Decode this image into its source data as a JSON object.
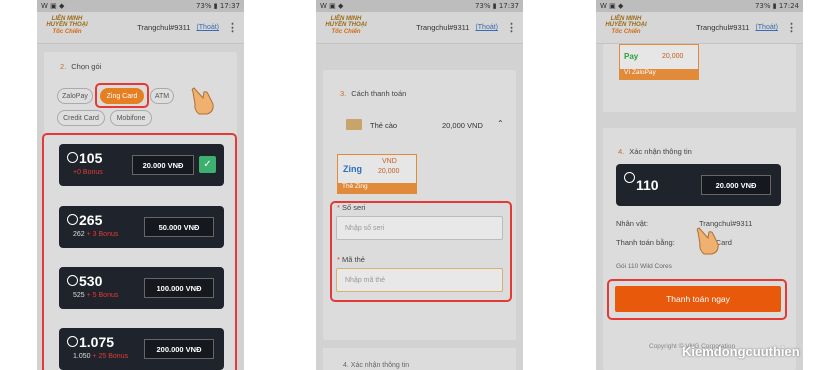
{
  "status": {
    "time1": "17:37",
    "time2": "17:37",
    "time3": "17:24",
    "battery": "73%"
  },
  "header": {
    "logo_line1": "LIÊN MINH",
    "logo_line2": "HUYỀN THOẠI",
    "logo_tag": "Tốc Chiến",
    "user": "Trangchul#9311",
    "logout": "(Thoát)"
  },
  "panel1": {
    "section_num": "2.",
    "section_title": "Chọn gói",
    "methods": [
      "ZaloPay",
      "Zing Card",
      "ATM",
      "Credit Card",
      "Mobifone"
    ],
    "packages": [
      {
        "amount": "105",
        "sub_base": "",
        "sub_bonus": "+0 Bonus",
        "price": "20.000 VNĐ"
      },
      {
        "amount": "265",
        "sub_base": "262",
        "sub_bonus": "+ 3 Bonus",
        "price": "50.000 VNĐ"
      },
      {
        "amount": "530",
        "sub_base": "525",
        "sub_bonus": "+ 5 Bonus",
        "price": "100.000 VNĐ"
      },
      {
        "amount": "1.075",
        "sub_base": "1.050",
        "sub_bonus": "+ 25 Bonus",
        "price": "200.000 VNĐ"
      }
    ]
  },
  "panel2": {
    "section_num": "3.",
    "section_title": "Cách thanh toán",
    "card_type": "Thẻ cào",
    "card_value": "20,000 VND",
    "zing_logo": "Zing",
    "zing_vnd": "VND",
    "zing_amount": "20,000",
    "zing_caption": "Thẻ Zing",
    "serial_label": "Số seri",
    "serial_placeholder": "Nhập số seri",
    "code_label": "Mã thẻ",
    "code_placeholder": "Nhập mã thẻ",
    "next_section": "4. Xác nhận thông tin"
  },
  "panel3": {
    "pay_amount": "20,000",
    "pay_caption": "Ví ZaloPay",
    "pay_logo": "Pay",
    "section_num": "4.",
    "section_title": "Xác nhận thông tin",
    "amount": "110",
    "price": "20.000 VNĐ",
    "char_label": "Nhân vật:",
    "char_value": "Trangchul#9311",
    "payby_label": "Thanh toán bằng:",
    "payby_value": "Zing Card",
    "pkg_name": "Gói 110 Wild Cores",
    "pay_button": "Thanh toán ngay",
    "footer": "Copyright © VNG Corporation"
  },
  "watermark": "Kiemdongcuuthien"
}
